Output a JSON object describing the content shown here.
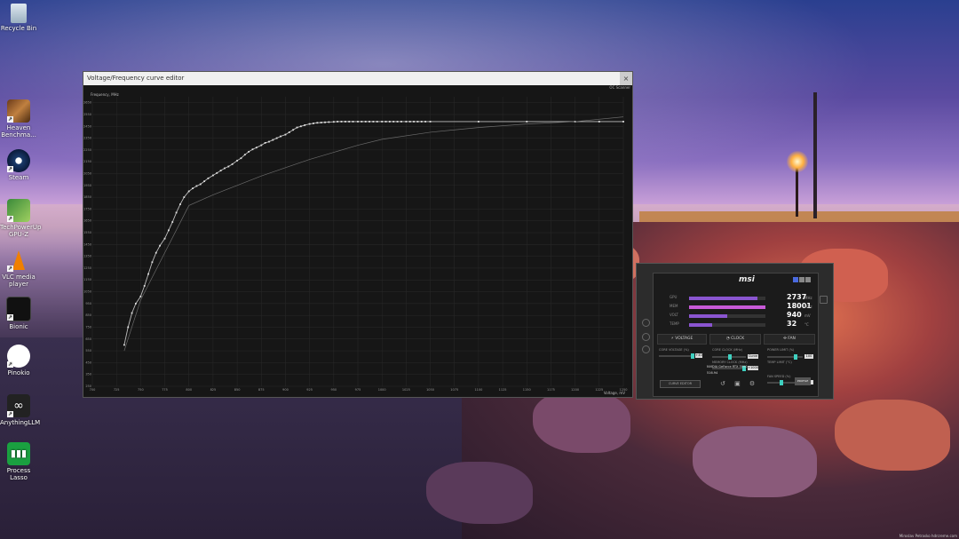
{
  "desktop": {
    "icons": [
      {
        "label": "Recycle Bin",
        "icon": "recycle-bin-icon"
      },
      {
        "label": "Heaven Benchma...",
        "icon": "heaven-benchmark-icon"
      },
      {
        "label": "Steam",
        "icon": "steam-icon"
      },
      {
        "label": "TechPowerUp GPU-Z",
        "icon": "gpu-z-icon"
      },
      {
        "label": "VLC media player",
        "icon": "vlc-icon"
      },
      {
        "label": "Bionic",
        "icon": "bionic-icon"
      },
      {
        "label": "Pinokio",
        "icon": "pinokio-icon"
      },
      {
        "label": "AnythingLLM",
        "icon": "anythingllm-icon"
      },
      {
        "label": "Process Lasso",
        "icon": "process-lasso-icon"
      }
    ],
    "credit": "Miroslav Petrasko hdrcreme.com"
  },
  "vf_editor": {
    "title": "Voltage/Frequency curve editor",
    "oc_scanner": "OC Scanner",
    "y_axis_label": "Frequency, MHz",
    "x_axis_label": "Voltage, mV",
    "close_glyph": "×"
  },
  "chart_data": {
    "type": "line",
    "xlabel": "Voltage, mV",
    "ylabel": "Frequency, MHz",
    "xlim": [
      700,
      1250
    ],
    "ylim": [
      250,
      2700
    ],
    "x_ticks": [
      "700",
      "725",
      "750",
      "775",
      "800",
      "825",
      "850",
      "875",
      "900",
      "925",
      "950",
      "975",
      "1000",
      "1025",
      "1050",
      "1075",
      "1100",
      "1125",
      "1150",
      "1175",
      "1200",
      "1225",
      "1250"
    ],
    "y_ticks": [
      "250",
      "350",
      "450",
      "550",
      "650",
      "750",
      "850",
      "950",
      "1050",
      "1150",
      "1250",
      "1350",
      "1450",
      "1550",
      "1650",
      "1750",
      "1850",
      "1950",
      "2050",
      "2150",
      "2250",
      "2350",
      "2450",
      "2550",
      "2650"
    ],
    "grid": true,
    "series": [
      {
        "x": [
          733,
          737,
          741,
          745,
          750,
          754,
          758,
          762,
          766,
          770,
          775,
          779,
          783,
          787,
          791,
          795,
          800,
          804,
          808,
          812,
          816,
          820,
          825,
          829,
          833,
          837,
          841,
          845,
          850,
          854,
          858,
          862,
          866,
          870,
          875,
          879,
          883,
          887,
          891,
          895,
          900,
          904,
          908,
          912,
          916,
          920,
          925,
          929,
          933,
          937,
          941,
          945,
          950,
          954,
          958,
          962,
          966,
          970,
          975,
          979,
          983,
          987,
          991,
          995,
          1000,
          1004,
          1008,
          1012,
          1016,
          1020,
          1025,
          1029,
          1033,
          1037,
          1041,
          1045,
          1050,
          1100,
          1150,
          1200,
          1225,
          1250
        ],
        "y": [
          600,
          750,
          870,
          950,
          1010,
          1100,
          1200,
          1300,
          1380,
          1440,
          1500,
          1570,
          1640,
          1720,
          1790,
          1850,
          1900,
          1925,
          1945,
          1960,
          1985,
          2010,
          2035,
          2055,
          2075,
          2095,
          2110,
          2130,
          2160,
          2180,
          2210,
          2235,
          2255,
          2270,
          2290,
          2310,
          2320,
          2335,
          2350,
          2365,
          2380,
          2400,
          2420,
          2440,
          2450,
          2460,
          2470,
          2475,
          2480,
          2482,
          2484,
          2486,
          2488,
          2490,
          2490,
          2490,
          2490,
          2490,
          2490,
          2490,
          2490,
          2490,
          2490,
          2490,
          2490,
          2490,
          2490,
          2490,
          2490,
          2490,
          2490,
          2490,
          2490,
          2490,
          2490,
          2490,
          2490,
          2490,
          2490,
          2490,
          2490,
          2490
        ]
      },
      {
        "x": [
          733,
          750,
          775,
          800,
          825,
          850,
          875,
          900,
          925,
          950,
          975,
          1000,
          1050,
          1100,
          1150,
          1200,
          1250
        ],
        "y": [
          550,
          980,
          1380,
          1780,
          1870,
          1950,
          2030,
          2100,
          2170,
          2230,
          2290,
          2340,
          2400,
          2440,
          2470,
          2490,
          2530
        ]
      }
    ]
  },
  "afterburner": {
    "logo": "msi",
    "monitors": [
      {
        "label": "GPU",
        "value": "2737",
        "unit": "MHz",
        "color": "#8a55d0",
        "fill": 0.9
      },
      {
        "label": "MEM",
        "value": "18001",
        "unit": "MHz",
        "color": "#c85ad8",
        "fill": 1.0
      },
      {
        "label": "VOLT",
        "value": "940",
        "unit": "mV",
        "color": "#8a55d0",
        "fill": 0.5
      },
      {
        "label": "TEMP",
        "value": "32",
        "unit": "°C",
        "color": "#8a55d0",
        "fill": 0.3
      }
    ],
    "tabs": {
      "voltage": "VOLTAGE",
      "clock": "CLOCK",
      "fan": "FAN"
    },
    "controls": {
      "core_voltage": "CORE VOLTAGE (%)",
      "core_voltage_val": "+40",
      "core_clock": "CORE CLOCK (MHz)",
      "core_clock_val": "Curve",
      "memory_clock": "MEMORY CLOCK (MHz)",
      "memory_clock_val": "+1000",
      "power_limit": "POWER LIMIT (%)",
      "power_limit_val": "100",
      "temp_limit": "TEMP LIMIT (°C)",
      "fan_speed": "FAN SPEED (%)",
      "fan_speed_val": "38"
    },
    "gpu_name": "NVIDIA GeForce RTX 3090",
    "driver": "516.94",
    "curve_editor": "CURVE EDITOR",
    "bottom_icons": "↺ ▣ ⚙",
    "profile_label": "PROFILE"
  }
}
